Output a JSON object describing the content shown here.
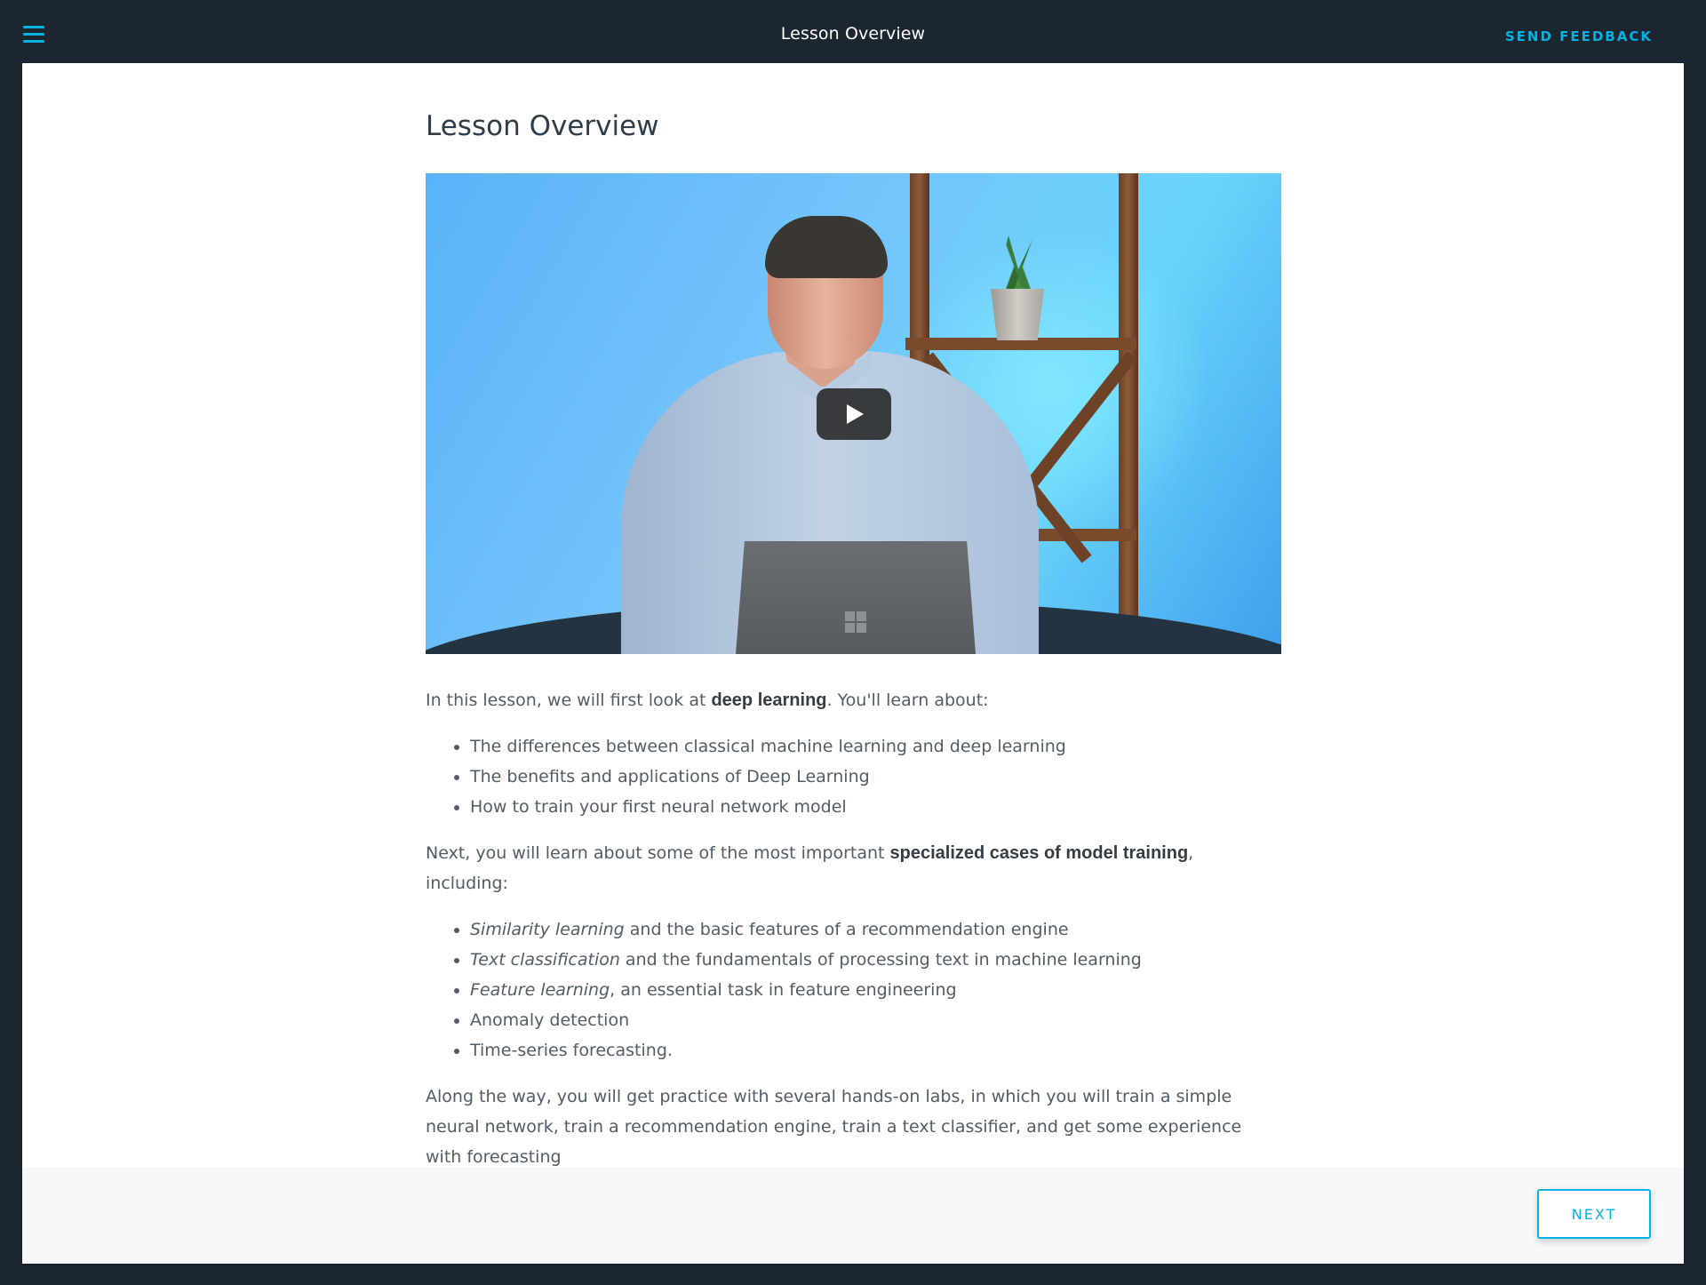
{
  "header": {
    "menu_icon": "hamburger-menu-icon",
    "title": "Lesson Overview",
    "feedback_label": "SEND FEEDBACK"
  },
  "colors": {
    "accent": "#02b3e4",
    "header_bg": "#1c2630",
    "title_text": "#2e3d49",
    "body_text": "#525c65"
  },
  "lesson": {
    "title": "Lesson Overview",
    "video": {
      "play_icon": "play-icon"
    },
    "intro": {
      "before": "In this lesson, we will first look at ",
      "bold": "deep learning",
      "after": ". You'll learn about:"
    },
    "list1": [
      "The differences between classical machine learning and deep learning",
      "The benefits and applications of Deep Learning",
      "How to train your first neural network model"
    ],
    "next_para": {
      "before": "Next, you will learn about some of the most important ",
      "bold": "specialized cases of model training",
      "after": ", including:"
    },
    "list2": [
      {
        "em": "Similarity learning",
        "text": " and the basic features of a recommendation engine"
      },
      {
        "em": "Text classification",
        "text": " and the fundamentals of processing text in machine learning"
      },
      {
        "em": "Feature learning",
        "text": ", an essential task in feature engineering"
      },
      {
        "em": "",
        "text": "Anomaly detection"
      },
      {
        "em": "",
        "text": "Time-series forecasting."
      }
    ],
    "closing": "Along the way, you will get practice with several hands-on labs, in which you will train a simple neural network, train a recommendation engine, train a text classifier, and get some experience with forecasting"
  },
  "footer": {
    "next_label": "NEXT"
  }
}
